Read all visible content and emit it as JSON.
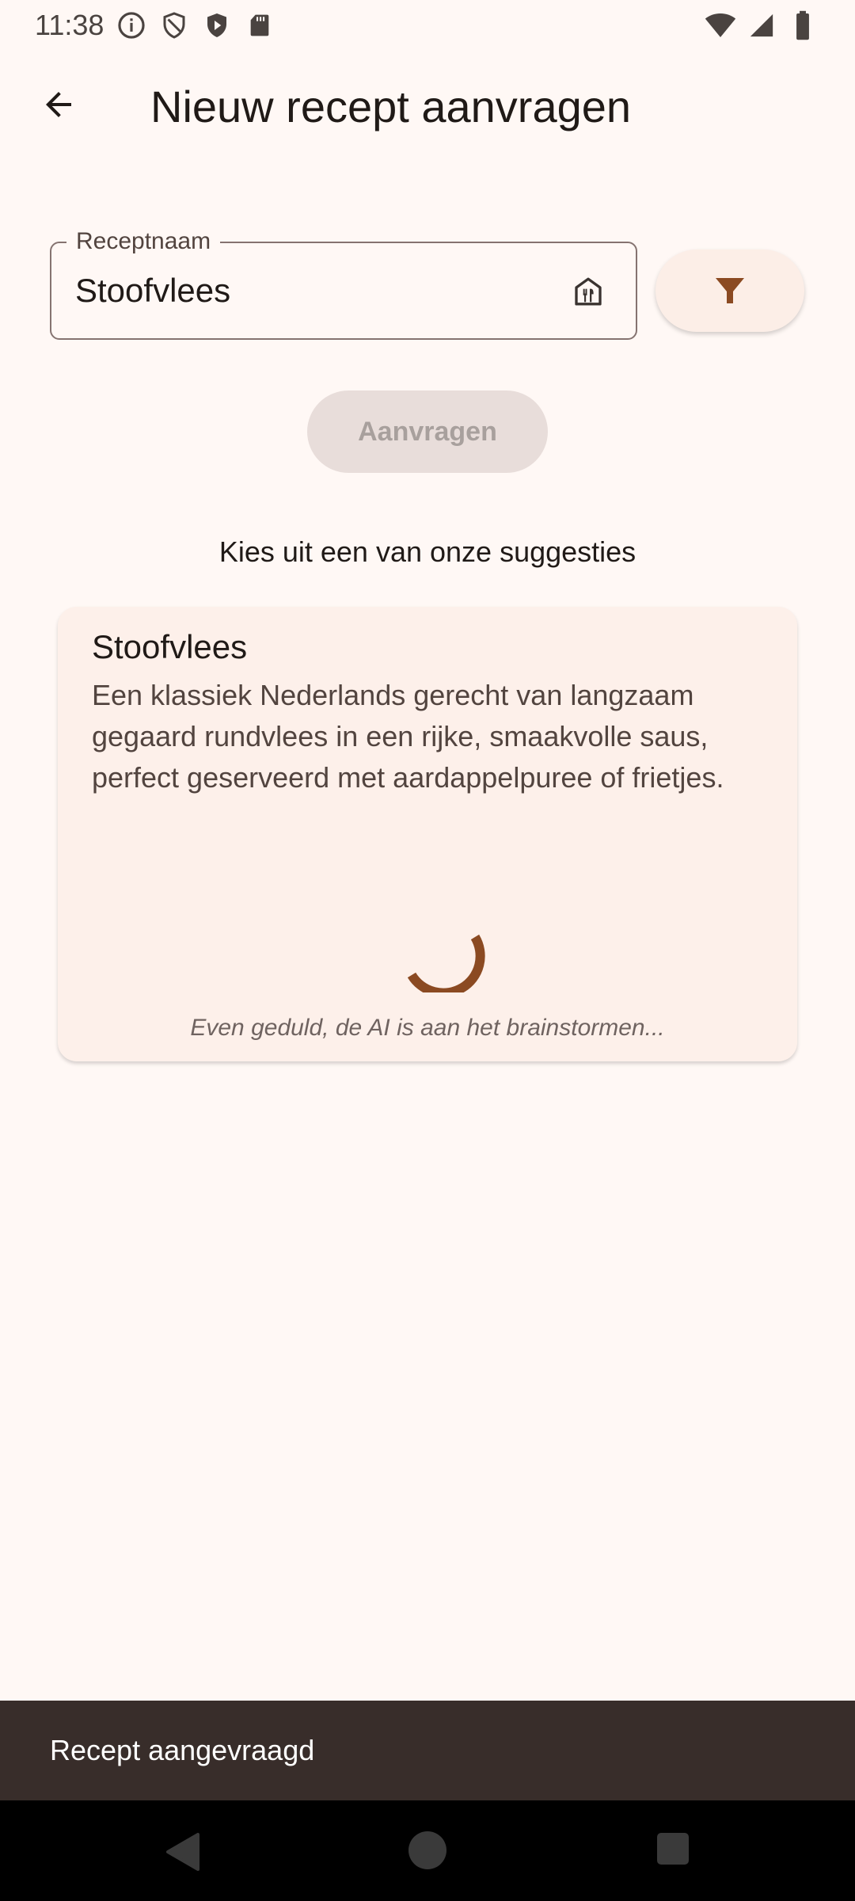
{
  "status_bar": {
    "time": "11:38",
    "left_icons": [
      "info-icon",
      "shield-outline-icon",
      "shield-play-icon",
      "sd-card-icon"
    ],
    "right_icons": [
      "wifi-icon",
      "signal-icon",
      "battery-icon"
    ]
  },
  "app_bar": {
    "back_icon": "arrow-back-icon",
    "title": "Nieuw recept aanvragen"
  },
  "form": {
    "recipe_name_label": "Receptnaam",
    "recipe_name_value": "Stoofvlees",
    "field_icon": "restaurant-house-icon",
    "filter_icon": "filter-icon",
    "request_button_label": "Aanvragen",
    "request_button_enabled": false
  },
  "suggestions": {
    "heading": "Kies uit een van onze suggesties",
    "items": [
      {
        "title": "Stoofvlees",
        "description": "Een klassiek Nederlands gerecht van langzaam gegaard rundvlees in een rijke, smaakvolle saus, perfect geserveerd met aardappelpuree of frietjes.",
        "loading_text": "Even geduld, de AI is aan het brainstormen..."
      }
    ]
  },
  "snackbar": {
    "text": "Recept aangevraagd"
  },
  "colors": {
    "background": "#FFF8F5",
    "accent": "#8B4A22",
    "card": "#FDF0EA",
    "snackbar": "#382D2A"
  }
}
